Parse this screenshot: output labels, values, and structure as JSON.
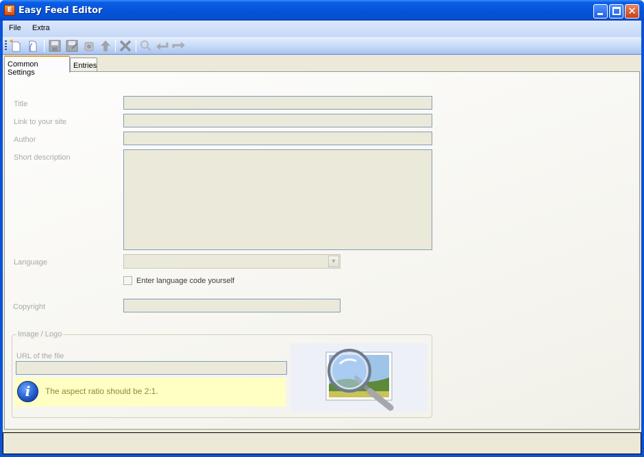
{
  "window": {
    "title": "Easy Feed Editor",
    "app_icon_glyph": "E",
    "buttons": [
      "minimize-icon",
      "maximize-icon",
      "close-icon"
    ]
  },
  "menubar": {
    "items": [
      {
        "label": "File"
      },
      {
        "label": "Extra"
      }
    ]
  },
  "toolbar": {
    "icons": [
      "new-file-icon",
      "open-file-icon",
      "save-icon",
      "save-as-icon",
      "export-icon",
      "upload-icon",
      "delete-icon",
      "search-icon",
      "undo-icon",
      "redo-icon"
    ]
  },
  "tabs": [
    {
      "label": "Common Settings",
      "active": true
    },
    {
      "label": "Entries",
      "active": false
    }
  ],
  "form": {
    "title_label": "Title",
    "title_value": "",
    "link_label": "Link to your site",
    "link_value": "",
    "author_label": "Author",
    "author_value": "",
    "description_label": "Short description",
    "description_value": "",
    "language_label": "Language",
    "language_value": "",
    "language_checkbox_label": "Enter language code yourself",
    "language_checkbox_checked": false,
    "copyright_label": "Copyright",
    "copyright_value": ""
  },
  "image_group": {
    "title": "Image / Logo",
    "url_label": "URL of the file",
    "url_value": "",
    "info_text": "The aspect ratio should be 2:1.",
    "info_icon": "info-icon",
    "preview_icon": "image-magnifier-icon"
  },
  "colors": {
    "titlebar": "#0654d9",
    "field_bg": "#ebe9d9",
    "info_bg": "#ffffc4",
    "info_text": "#8a8a3a",
    "label_disabled": "#a9a9a9"
  }
}
